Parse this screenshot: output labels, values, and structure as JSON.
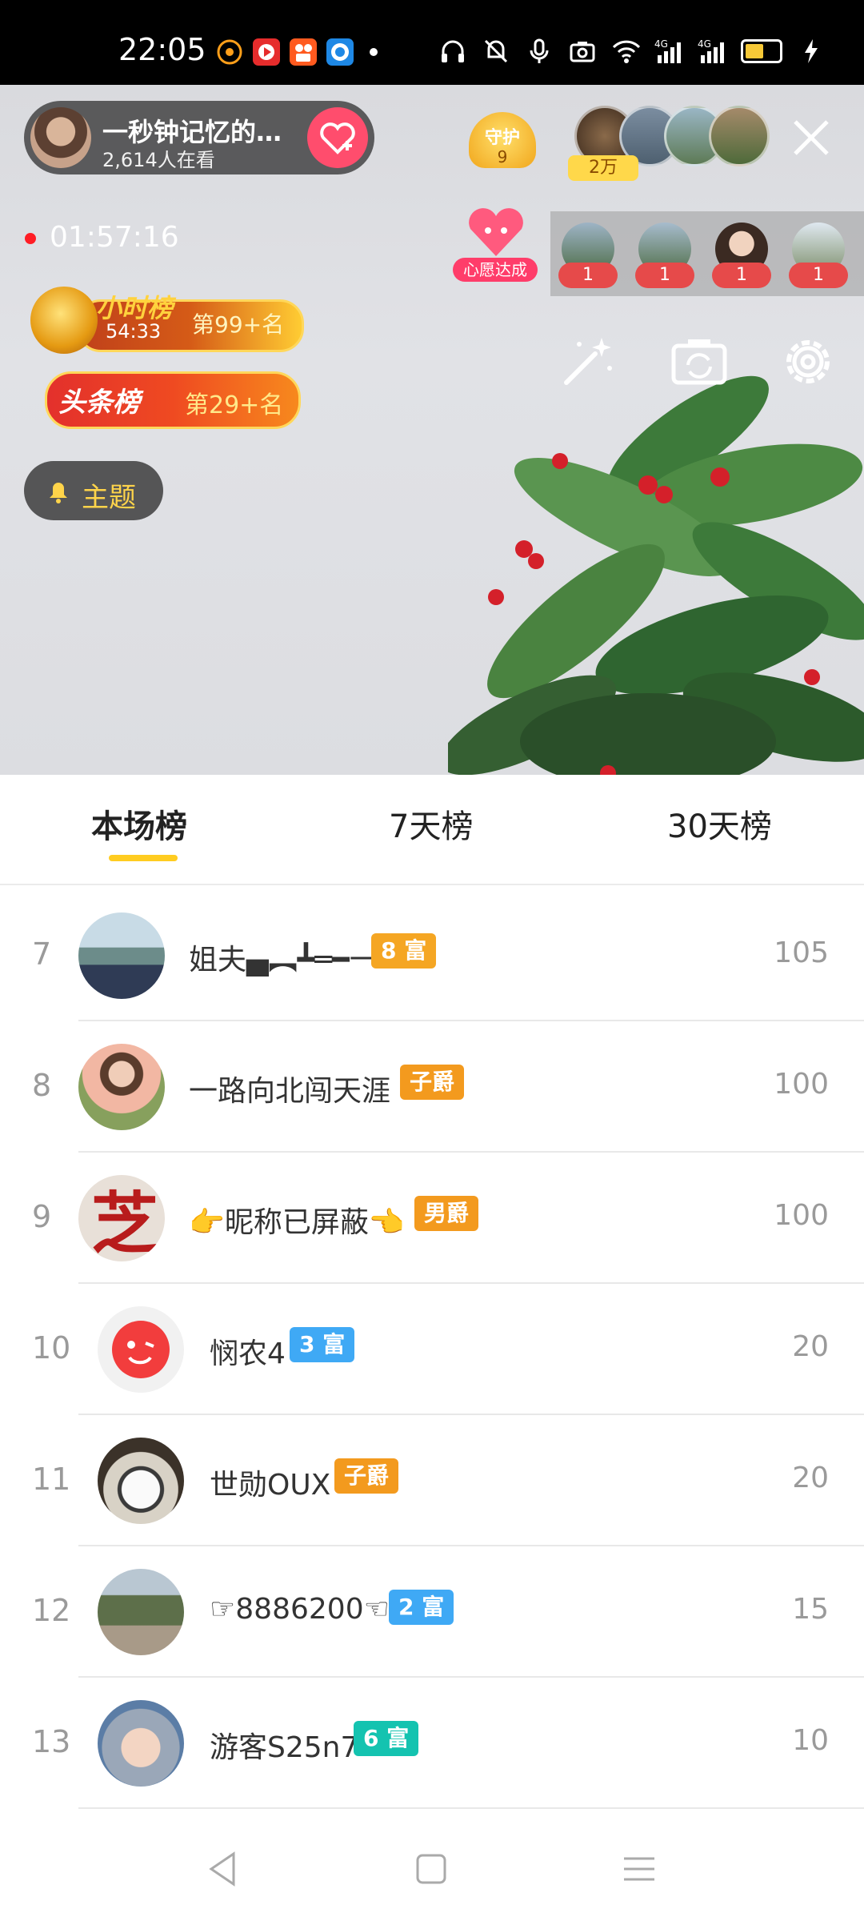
{
  "status_bar": {
    "time": "22:05",
    "left_app_icons": [
      "so-app-icon",
      "video-app-icon",
      "kuaishou-app-icon",
      "browser-app-icon"
    ],
    "right_icons": [
      "headphones-icon",
      "mute-icon",
      "microphone-icon",
      "camera-icon",
      "wifi-icon",
      "signal-4g-icon",
      "signal-4g-icon",
      "battery-charging-icon"
    ],
    "battery_color": "#f7c937"
  },
  "live": {
    "host_name": "一秒钟记忆的…",
    "viewers": "2,614人在看",
    "guard_label": "守护",
    "guard_count": "9",
    "audience_badge": "2万",
    "timer": "01:57:16",
    "hour_rank": {
      "title": "小时榜",
      "time": "54:33",
      "rank": "第99+名"
    },
    "top_rank": {
      "title": "头条榜",
      "rank": "第29+名"
    },
    "topic_label": "主题",
    "wish_label": "心愿达成",
    "wish_counts": [
      "1",
      "1",
      "1",
      "1"
    ],
    "accent_color": "#ff4d6d"
  },
  "tabs": [
    {
      "label": "本场榜",
      "active": true
    },
    {
      "label": "7天榜",
      "active": false
    },
    {
      "label": "30天榜",
      "active": false
    }
  ],
  "rows": [
    {
      "rank": "7",
      "name": "姐夫▄︻┻═━一",
      "badge": "8 富",
      "badge_color": "#f5a623",
      "score": "105"
    },
    {
      "rank": "8",
      "name": "一路向北闯天涯",
      "badge": "子爵",
      "badge_color": "#f39a1e",
      "score": "100"
    },
    {
      "rank": "9",
      "name": "👉昵称已屏蔽👈",
      "badge": "男爵",
      "badge_color": "#f39a1e",
      "score": "100"
    },
    {
      "rank": "10",
      "name": "悯农4",
      "badge": "3 富",
      "badge_color": "#3fa9f5",
      "score": "20"
    },
    {
      "rank": "11",
      "name": "世勋OUX",
      "badge": "子爵",
      "badge_color": "#f39a1e",
      "score": "20"
    },
    {
      "rank": "12",
      "name": "☞8886200☜",
      "badge": "2 富",
      "badge_color": "#3fa9f5",
      "score": "15"
    },
    {
      "rank": "13",
      "name": "游客S25n7",
      "badge": "6 富",
      "badge_color": "#14c3b0",
      "score": "10"
    }
  ],
  "nav": [
    "back-icon",
    "home-icon",
    "menu-icon"
  ]
}
